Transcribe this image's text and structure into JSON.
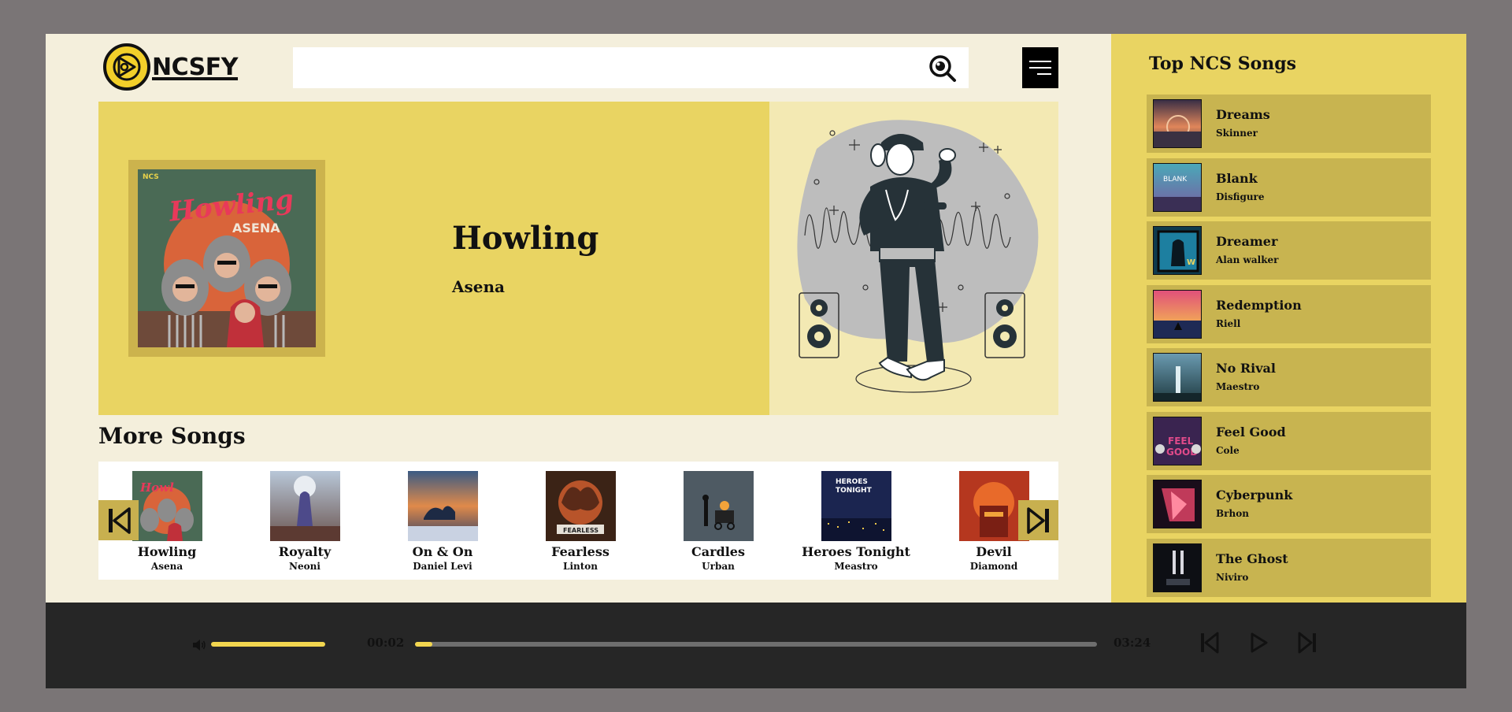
{
  "header": {
    "logo_text": "NCSFY",
    "search_placeholder": "",
    "search_icon": "search-icon",
    "menu_icon": "menu-icon"
  },
  "hero": {
    "title": "Howling",
    "artist": "Asena",
    "cover_label": "NCS",
    "cover_title": "Howling",
    "cover_artists": "Asena"
  },
  "more_songs": {
    "heading": "More Songs",
    "prev_icon": "skip-back-icon",
    "next_icon": "skip-forward-icon",
    "items": [
      {
        "title": "Howling",
        "artist": "Asena"
      },
      {
        "title": "Royalty",
        "artist": "Neoni"
      },
      {
        "title": "On & On",
        "artist": "Daniel Levi"
      },
      {
        "title": "Fearless",
        "artist": "Linton"
      },
      {
        "title": "Cardles",
        "artist": "Urban"
      },
      {
        "title": "Heroes Tonight",
        "artist": "Meastro"
      },
      {
        "title": "Devil",
        "artist": "Diamond"
      }
    ]
  },
  "top_songs": {
    "heading": "Top NCS Songs",
    "items": [
      {
        "title": "Dreams",
        "artist": "Skinner"
      },
      {
        "title": "Blank",
        "artist": "Disfigure"
      },
      {
        "title": "Dreamer",
        "artist": "Alan walker"
      },
      {
        "title": "Redemption",
        "artist": "Riell"
      },
      {
        "title": "No Rival",
        "artist": "Maestro"
      },
      {
        "title": "Feel Good",
        "artist": "Cole"
      },
      {
        "title": "Cyberpunk",
        "artist": "Brhon"
      },
      {
        "title": "The Ghost",
        "artist": "Niviro"
      }
    ]
  },
  "player": {
    "current_time": "00:02",
    "duration": "03:24",
    "progress_fraction": 0.025,
    "volume_fraction": 1.0,
    "accent_color": "#f2d64f"
  },
  "colors": {
    "accent_yellow": "#e9d462",
    "player_bg": "#262626",
    "main_bg": "#f4efdc",
    "page_bg": "#7a7576"
  }
}
